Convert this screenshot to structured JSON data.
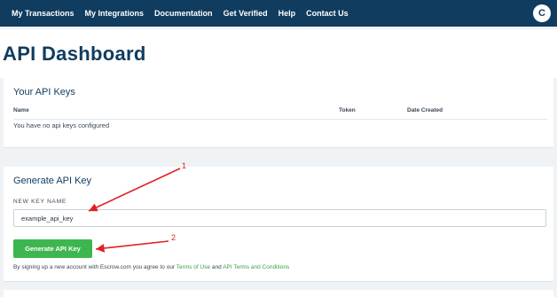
{
  "nav": {
    "items": [
      "My Transactions",
      "My Integrations",
      "Documentation",
      "Get Verified",
      "Help",
      "Contact Us"
    ],
    "avatar_initial": "C"
  },
  "page_title": "API Dashboard",
  "keys_card": {
    "title": "Your API Keys",
    "columns": [
      "Name",
      "Token",
      "Date Created"
    ],
    "empty_message": "You have no api keys configured"
  },
  "generate_card": {
    "title": "Generate API Key",
    "field_label": "NEW KEY NAME",
    "input_value": "example_api_key",
    "button_label": "Generate API Key",
    "disclaimer_prefix": "By signing up a new account with Escrow.com you agree to our ",
    "terms_link": "Terms of Use",
    "disclaimer_and": " and ",
    "api_terms_link": "API Terms and Conditions"
  },
  "annotations": {
    "label_1": "1",
    "label_2": "2",
    "color": "#e02020"
  },
  "colors": {
    "nav_bg": "#0f3c5f",
    "button_green": "#3eb64f",
    "link_green": "#3aa04a",
    "page_bg": "#f0f3f6"
  }
}
